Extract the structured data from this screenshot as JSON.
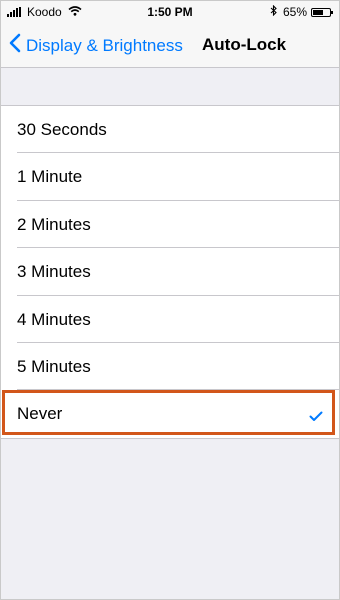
{
  "status_bar": {
    "carrier": "Koodo",
    "time": "1:50 PM",
    "battery_percent": "65%",
    "battery_level": 0.65
  },
  "nav": {
    "back_label": "Display & Brightness",
    "title": "Auto-Lock"
  },
  "options": [
    {
      "label": "30 Seconds",
      "selected": false
    },
    {
      "label": "1 Minute",
      "selected": false
    },
    {
      "label": "2 Minutes",
      "selected": false
    },
    {
      "label": "3 Minutes",
      "selected": false
    },
    {
      "label": "4 Minutes",
      "selected": false
    },
    {
      "label": "5 Minutes",
      "selected": false
    },
    {
      "label": "Never",
      "selected": true
    }
  ],
  "colors": {
    "accent": "#007aff",
    "highlight": "#d2561a"
  },
  "icons": {
    "back": "chevron-left-icon",
    "check": "checkmark-icon",
    "signal": "signal-bars-icon",
    "wifi": "wifi-icon",
    "bluetooth": "bluetooth-icon",
    "battery": "battery-icon"
  }
}
